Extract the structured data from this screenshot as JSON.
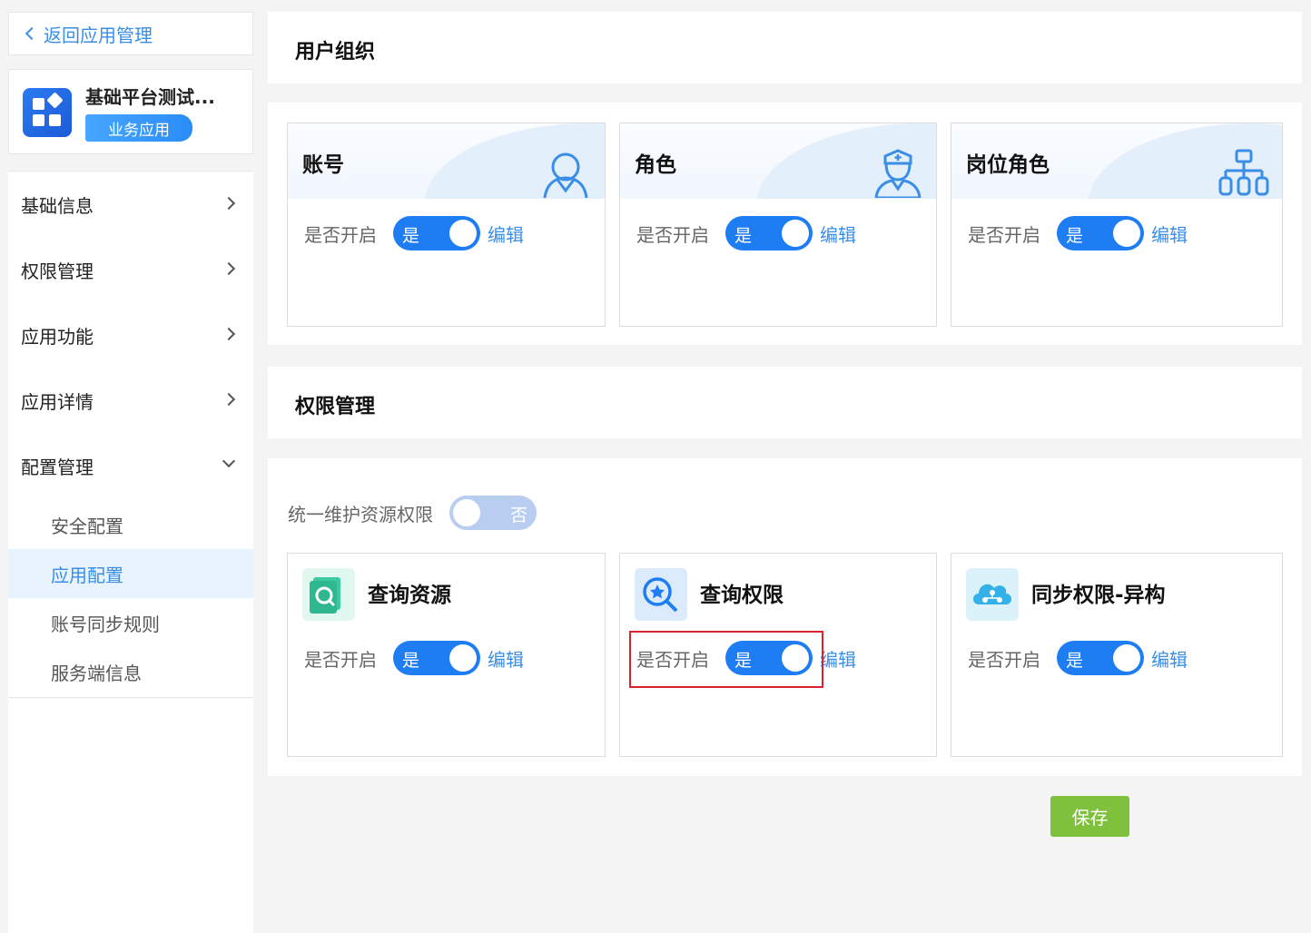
{
  "sidebar": {
    "back_label": "返回应用管理",
    "app": {
      "name": "基础平台测试...",
      "tag": "业务应用"
    },
    "menu": [
      {
        "label": "基础信息"
      },
      {
        "label": "权限管理"
      },
      {
        "label": "应用功能"
      },
      {
        "label": "应用详情"
      },
      {
        "label": "配置管理"
      }
    ],
    "submenu": [
      {
        "label": "安全配置"
      },
      {
        "label": "应用配置"
      },
      {
        "label": "账号同步规则"
      },
      {
        "label": "服务端信息"
      }
    ]
  },
  "user_org": {
    "title": "用户组织",
    "cards": [
      {
        "title": "账号",
        "label": "是否开启",
        "toggle": "是",
        "edit": "编辑",
        "icon": "user-icon"
      },
      {
        "title": "角色",
        "label": "是否开启",
        "toggle": "是",
        "edit": "编辑",
        "icon": "nurse-icon"
      },
      {
        "title": "岗位角色",
        "label": "是否开启",
        "toggle": "是",
        "edit": "编辑",
        "icon": "org-chart-icon"
      }
    ]
  },
  "perm": {
    "title": "权限管理",
    "unified_label": "统一维护资源权限",
    "unified_toggle": "否",
    "cards": [
      {
        "title": "查询资源",
        "label": "是否开启",
        "toggle": "是",
        "edit": "编辑",
        "icon": "search-resource-icon"
      },
      {
        "title": "查询权限",
        "label": "是否开启",
        "toggle": "是",
        "edit": "编辑",
        "icon": "search-permission-icon"
      },
      {
        "title": "同步权限-异构",
        "label": "是否开启",
        "toggle": "是",
        "edit": "编辑",
        "icon": "cloud-sync-icon"
      }
    ]
  },
  "save_label": "保存",
  "colors": {
    "primary": "#1e7df2",
    "link": "#3a8ee6",
    "save": "#7fc13c",
    "highlight": "#d9232d"
  }
}
